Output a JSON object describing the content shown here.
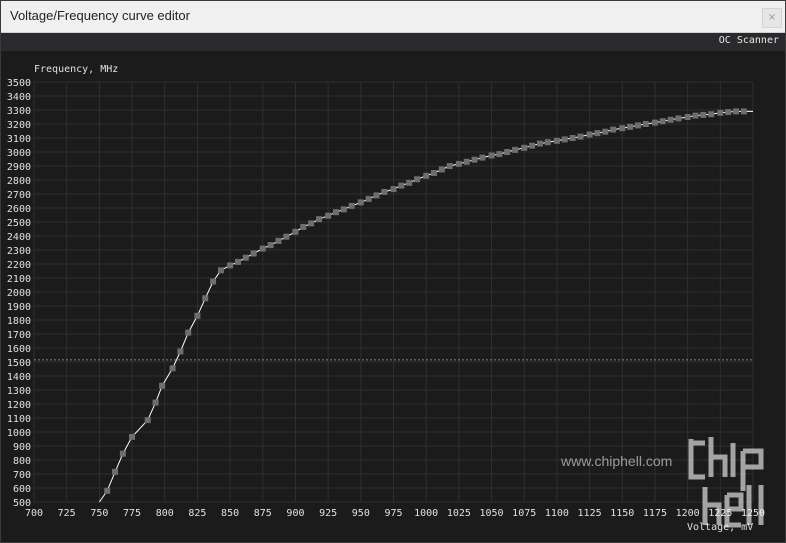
{
  "window": {
    "title": "Voltage/Frequency curve editor",
    "close_label": "×"
  },
  "toolbar": {
    "oc_scanner_label": "OC Scanner"
  },
  "watermark": {
    "logo_text": "chip hell",
    "url_text": "www.chiphell.com"
  },
  "colors": {
    "background": "#1b1b1c",
    "grid": "#2f2f31",
    "curve": "#ffffff",
    "point": "#6e6e6e",
    "reference_line": "#8a8a8a"
  },
  "chart_data": {
    "type": "line",
    "title": "",
    "xlabel": "Voltage, mV",
    "ylabel": "Frequency, MHz",
    "xlim": [
      700,
      1250
    ],
    "ylim": [
      500,
      3500
    ],
    "x_ticks": [
      700,
      725,
      750,
      775,
      800,
      825,
      850,
      875,
      900,
      925,
      950,
      975,
      1000,
      1025,
      1050,
      1075,
      1100,
      1125,
      1150,
      1175,
      1200,
      1225,
      1250
    ],
    "y_ticks": [
      500,
      600,
      700,
      800,
      900,
      1000,
      1100,
      1200,
      1300,
      1400,
      1500,
      1600,
      1700,
      1800,
      1900,
      2000,
      2100,
      2200,
      2300,
      2400,
      2500,
      2600,
      2700,
      2800,
      2900,
      3000,
      3100,
      3200,
      3300,
      3400,
      3500
    ],
    "grid": true,
    "reference_line_y": 1515,
    "series": [
      {
        "x": [
          750,
          756,
          762,
          768,
          775,
          787,
          793,
          798,
          806,
          812,
          818,
          825,
          831,
          837,
          843,
          850,
          856,
          862,
          868,
          875,
          881,
          887,
          893,
          900,
          906,
          912,
          918,
          925,
          931,
          937,
          943,
          950,
          956,
          962,
          968,
          975,
          981,
          987,
          993,
          1000,
          1006,
          1012,
          1018,
          1025,
          1031,
          1037,
          1043,
          1050,
          1056,
          1062,
          1068,
          1075,
          1081,
          1087,
          1093,
          1100,
          1106,
          1112,
          1118,
          1125,
          1131,
          1137,
          1143,
          1150,
          1156,
          1162,
          1168,
          1175,
          1181,
          1187,
          1193,
          1200,
          1206,
          1212,
          1218,
          1225,
          1231,
          1237,
          1243,
          1250
        ],
        "y": [
          500,
          580,
          715,
          845,
          965,
          1085,
          1210,
          1330,
          1455,
          1575,
          1710,
          1830,
          1955,
          2075,
          2155,
          2190,
          2215,
          2245,
          2275,
          2310,
          2335,
          2365,
          2395,
          2430,
          2465,
          2490,
          2520,
          2545,
          2570,
          2590,
          2615,
          2640,
          2665,
          2690,
          2715,
          2735,
          2760,
          2780,
          2805,
          2830,
          2850,
          2875,
          2900,
          2915,
          2930,
          2945,
          2960,
          2975,
          2985,
          3000,
          3015,
          3030,
          3045,
          3060,
          3070,
          3080,
          3090,
          3100,
          3110,
          3125,
          3135,
          3145,
          3160,
          3170,
          3180,
          3190,
          3200,
          3210,
          3220,
          3230,
          3240,
          3250,
          3260,
          3265,
          3270,
          3280,
          3285,
          3290,
          3290,
          3290
        ],
        "point_mask": [
          0,
          1,
          1,
          1,
          1,
          1,
          1,
          1,
          1,
          1,
          1,
          1,
          1,
          1,
          1,
          1,
          1,
          1,
          1,
          1,
          1,
          1,
          1,
          1,
          1,
          1,
          1,
          1,
          1,
          1,
          1,
          1,
          1,
          1,
          1,
          1,
          1,
          1,
          1,
          1,
          1,
          1,
          1,
          1,
          1,
          1,
          1,
          1,
          1,
          1,
          1,
          1,
          1,
          1,
          1,
          1,
          1,
          1,
          1,
          1,
          1,
          1,
          1,
          1,
          1,
          1,
          1,
          1,
          1,
          1,
          1,
          1,
          1,
          1,
          1,
          1,
          1,
          1,
          1,
          0
        ]
      }
    ]
  }
}
